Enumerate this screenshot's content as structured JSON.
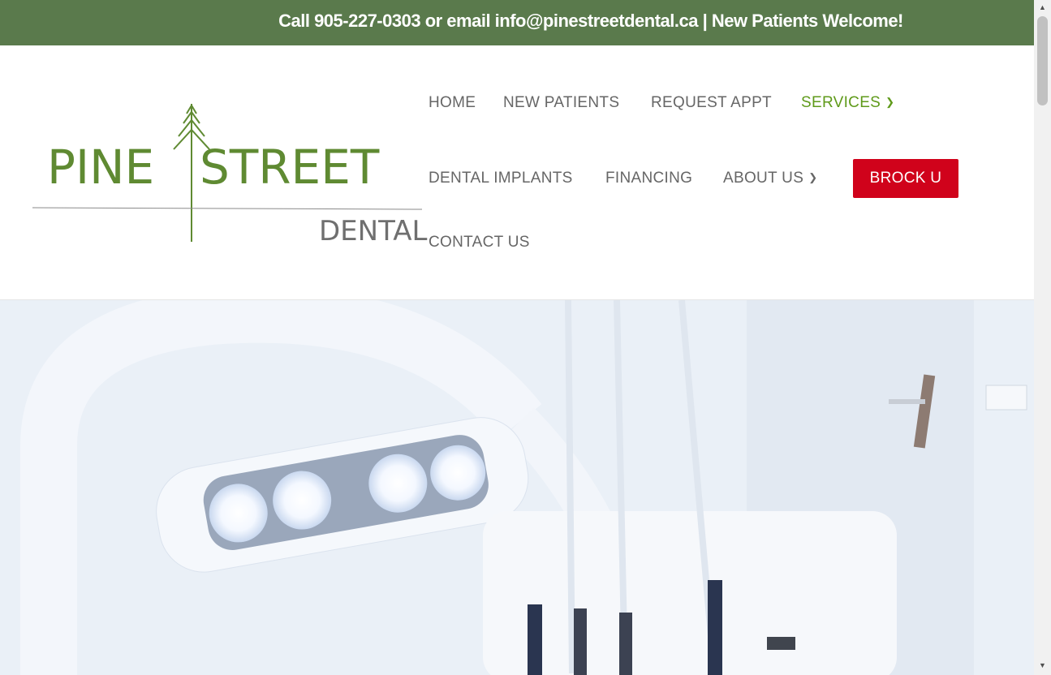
{
  "topbar": {
    "message": "Call 905-227-0303 or email info@pinestreetdental.ca | New Patients Welcome!"
  },
  "logo": {
    "line1_left": "PINE",
    "line1_right": "STREET",
    "line2": "DENTAL"
  },
  "nav": {
    "home": "HOME",
    "new_patients": "NEW PATIENTS",
    "request_appt": "REQUEST APPT",
    "services": "SERVICES",
    "dental_implants": "DENTAL IMPLANTS",
    "financing": "FINANCING",
    "about_us": "ABOUT US",
    "brock_u": "BROCK U",
    "contact_us": "CONTACT US"
  },
  "icons": {
    "dropdown": "chevron-down-icon",
    "scroll_up": "arrow-up-icon",
    "scroll_down": "arrow-down-icon"
  },
  "colors": {
    "topbar": "#5a7a4c",
    "nav_active": "#5f9a1a",
    "nav_text": "#666666",
    "brock_button": "#d0021b",
    "logo_green": "#5f8a32",
    "logo_gray": "#6f6f6f"
  }
}
